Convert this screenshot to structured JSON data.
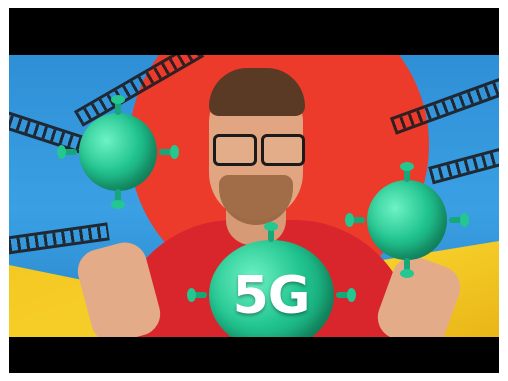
{
  "overlay": {
    "label": "5G"
  },
  "colors": {
    "letterbox": "#000000",
    "sky": "#3aa0e3",
    "sun": "#ec3b2b",
    "ground": "#f4c61f",
    "virus": "#21c48f",
    "shirt": "#d9262c"
  },
  "icons": [
    "virus-icon"
  ]
}
